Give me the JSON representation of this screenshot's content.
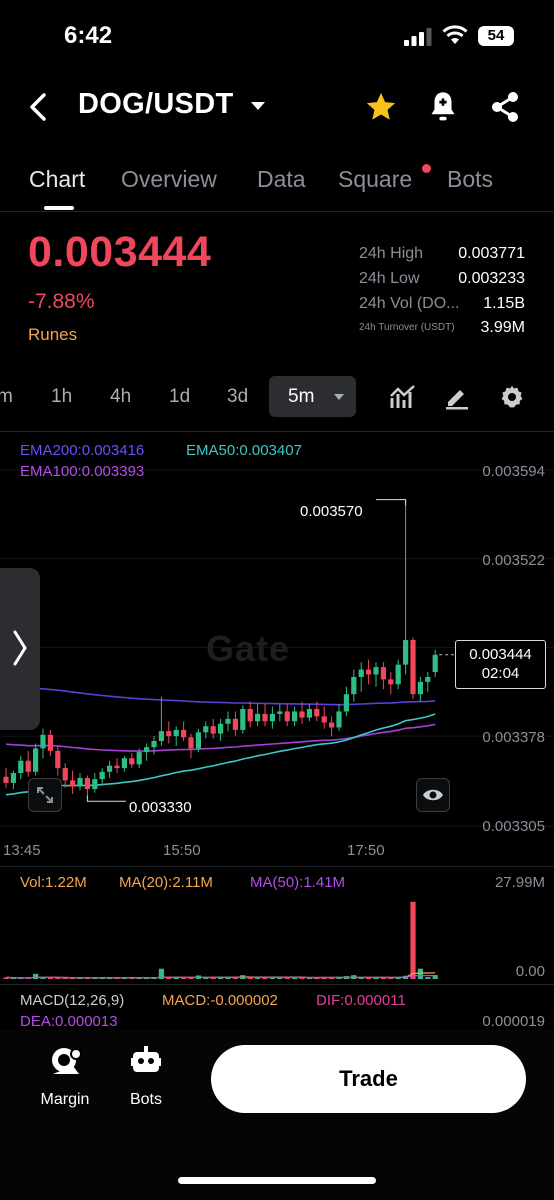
{
  "status_bar": {
    "time": "6:42",
    "battery": "54"
  },
  "header": {
    "pair": "DOG/USDT"
  },
  "tabs": [
    {
      "label": "Chart"
    },
    {
      "label": "Overview"
    },
    {
      "label": "Data"
    },
    {
      "label": "Square"
    },
    {
      "label": "Bots"
    }
  ],
  "ticker": {
    "price": "0.003444",
    "change": "-7.88%",
    "tag": "Runes",
    "stats": [
      {
        "label": "24h High",
        "value": "0.003771"
      },
      {
        "label": "24h Low",
        "value": "0.003233"
      },
      {
        "label": "24h Vol (DO...",
        "value": "1.15B"
      },
      {
        "label": "24h Turnover (USDT)",
        "value": "3.99M"
      }
    ]
  },
  "intervals": [
    "m",
    "1h",
    "4h",
    "1d",
    "3d"
  ],
  "selected_interval": "5m",
  "chart": {
    "ema200": "EMA200:0.003416",
    "ema50": "EMA50:0.003407",
    "ema100": "EMA100:0.003393",
    "price_axis": [
      "0.003594",
      "0.003522",
      "0.003378",
      "0.003305"
    ],
    "high_marker": "0.003570",
    "low_marker": "0.003330",
    "current_price": "0.003444",
    "countdown": "02:04",
    "time_axis": [
      "13:45",
      "15:50",
      "17:50"
    ],
    "watermark": "Gate",
    "colors": {
      "up": "#2ebd85",
      "down": "#f0475d",
      "ema200": "#5b3fd6",
      "ema50": "#3cc8c8",
      "ema100": "#a63fd6"
    }
  },
  "volume": {
    "vol": "Vol:1.22M",
    "ma20": "MA(20):2.11M",
    "ma50": "MA(50):1.41M",
    "axis_top": "27.99M",
    "axis_bottom": "0.00"
  },
  "macd": {
    "title": "MACD(12,26,9)",
    "macd": "MACD:-0.000002",
    "dif": "DIF:0.000011",
    "dea": "DEA:0.000013",
    "axis": "0.000019"
  },
  "bottom_bar": {
    "margin": "Margin",
    "bots": "Bots",
    "trade": "Trade"
  },
  "candles": [
    {
      "o": 0.003345,
      "h": 0.003352,
      "l": 0.003336,
      "c": 0.00334
    },
    {
      "o": 0.00334,
      "h": 0.00335,
      "l": 0.003335,
      "c": 0.003348
    },
    {
      "o": 0.003348,
      "h": 0.003362,
      "l": 0.003343,
      "c": 0.003358
    },
    {
      "o": 0.003358,
      "h": 0.003366,
      "l": 0.003345,
      "c": 0.003349
    },
    {
      "o": 0.003349,
      "h": 0.003372,
      "l": 0.003346,
      "c": 0.003368
    },
    {
      "o": 0.003368,
      "h": 0.003384,
      "l": 0.00336,
      "c": 0.003379
    },
    {
      "o": 0.003379,
      "h": 0.003383,
      "l": 0.003362,
      "c": 0.003366
    },
    {
      "o": 0.003366,
      "h": 0.00337,
      "l": 0.003346,
      "c": 0.003352
    },
    {
      "o": 0.003352,
      "h": 0.003356,
      "l": 0.003336,
      "c": 0.003342
    },
    {
      "o": 0.003342,
      "h": 0.00335,
      "l": 0.003331,
      "c": 0.003337
    },
    {
      "o": 0.003337,
      "h": 0.003348,
      "l": 0.003334,
      "c": 0.003344
    },
    {
      "o": 0.003344,
      "h": 0.003346,
      "l": 0.00333,
      "c": 0.003335
    },
    {
      "o": 0.003335,
      "h": 0.003348,
      "l": 0.003332,
      "c": 0.003343
    },
    {
      "o": 0.003343,
      "h": 0.003352,
      "l": 0.003338,
      "c": 0.003349
    },
    {
      "o": 0.003349,
      "h": 0.003358,
      "l": 0.003344,
      "c": 0.003354
    },
    {
      "o": 0.003354,
      "h": 0.00336,
      "l": 0.003348,
      "c": 0.003352
    },
    {
      "o": 0.003352,
      "h": 0.003362,
      "l": 0.003349,
      "c": 0.00336
    },
    {
      "o": 0.00336,
      "h": 0.003364,
      "l": 0.003352,
      "c": 0.003355
    },
    {
      "o": 0.003355,
      "h": 0.003368,
      "l": 0.003352,
      "c": 0.003365
    },
    {
      "o": 0.003365,
      "h": 0.003372,
      "l": 0.003358,
      "c": 0.003369
    },
    {
      "o": 0.003369,
      "h": 0.003378,
      "l": 0.003363,
      "c": 0.003374
    },
    {
      "o": 0.003374,
      "h": 0.00341,
      "l": 0.00337,
      "c": 0.003382
    },
    {
      "o": 0.003382,
      "h": 0.00339,
      "l": 0.003372,
      "c": 0.003378
    },
    {
      "o": 0.003378,
      "h": 0.003386,
      "l": 0.00337,
      "c": 0.003383
    },
    {
      "o": 0.003383,
      "h": 0.00339,
      "l": 0.003374,
      "c": 0.003377
    },
    {
      "o": 0.003377,
      "h": 0.00338,
      "l": 0.00336,
      "c": 0.003368
    },
    {
      "o": 0.003368,
      "h": 0.003384,
      "l": 0.003365,
      "c": 0.003381
    },
    {
      "o": 0.003381,
      "h": 0.00339,
      "l": 0.003376,
      "c": 0.003386
    },
    {
      "o": 0.003386,
      "h": 0.003392,
      "l": 0.003376,
      "c": 0.00338
    },
    {
      "o": 0.00338,
      "h": 0.003392,
      "l": 0.003374,
      "c": 0.003388
    },
    {
      "o": 0.003388,
      "h": 0.003398,
      "l": 0.003382,
      "c": 0.003392
    },
    {
      "o": 0.003392,
      "h": 0.003398,
      "l": 0.003378,
      "c": 0.003383
    },
    {
      "o": 0.003383,
      "h": 0.003403,
      "l": 0.00338,
      "c": 0.0034
    },
    {
      "o": 0.0034,
      "h": 0.003406,
      "l": 0.003385,
      "c": 0.00339
    },
    {
      "o": 0.00339,
      "h": 0.003404,
      "l": 0.003386,
      "c": 0.003396
    },
    {
      "o": 0.003396,
      "h": 0.003404,
      "l": 0.003386,
      "c": 0.00339
    },
    {
      "o": 0.00339,
      "h": 0.003402,
      "l": 0.003384,
      "c": 0.003396
    },
    {
      "o": 0.003396,
      "h": 0.003404,
      "l": 0.00339,
      "c": 0.003398
    },
    {
      "o": 0.003398,
      "h": 0.003404,
      "l": 0.003386,
      "c": 0.00339
    },
    {
      "o": 0.00339,
      "h": 0.003402,
      "l": 0.003386,
      "c": 0.003398
    },
    {
      "o": 0.003398,
      "h": 0.003406,
      "l": 0.003388,
      "c": 0.003393
    },
    {
      "o": 0.003393,
      "h": 0.003404,
      "l": 0.00339,
      "c": 0.0034
    },
    {
      "o": 0.0034,
      "h": 0.003406,
      "l": 0.00339,
      "c": 0.003394
    },
    {
      "o": 0.003394,
      "h": 0.003402,
      "l": 0.003384,
      "c": 0.003389
    },
    {
      "o": 0.003389,
      "h": 0.003394,
      "l": 0.003378,
      "c": 0.003385
    },
    {
      "o": 0.003385,
      "h": 0.003404,
      "l": 0.003382,
      "c": 0.003398
    },
    {
      "o": 0.003398,
      "h": 0.003418,
      "l": 0.003394,
      "c": 0.003412
    },
    {
      "o": 0.003412,
      "h": 0.003432,
      "l": 0.003406,
      "c": 0.003426
    },
    {
      "o": 0.003426,
      "h": 0.003438,
      "l": 0.003414,
      "c": 0.003432
    },
    {
      "o": 0.003432,
      "h": 0.00344,
      "l": 0.00342,
      "c": 0.003428
    },
    {
      "o": 0.003428,
      "h": 0.003438,
      "l": 0.003418,
      "c": 0.003434
    },
    {
      "o": 0.003434,
      "h": 0.003438,
      "l": 0.003416,
      "c": 0.003424
    },
    {
      "o": 0.003424,
      "h": 0.00343,
      "l": 0.003412,
      "c": 0.00342
    },
    {
      "o": 0.00342,
      "h": 0.00344,
      "l": 0.003416,
      "c": 0.003436
    },
    {
      "o": 0.003436,
      "h": 0.00357,
      "l": 0.003428,
      "c": 0.003456
    },
    {
      "o": 0.003456,
      "h": 0.003458,
      "l": 0.003408,
      "c": 0.003412
    },
    {
      "o": 0.003412,
      "h": 0.003426,
      "l": 0.003406,
      "c": 0.003422
    },
    {
      "o": 0.003422,
      "h": 0.00343,
      "l": 0.003414,
      "c": 0.003426
    },
    {
      "o": 0.00343,
      "h": 0.003448,
      "l": 0.003426,
      "c": 0.003444
    }
  ],
  "volumes": [
    0.5,
    0.4,
    0.2,
    0.1,
    1.6,
    0.3,
    0.5,
    0.3,
    0.4,
    0.2,
    0.3,
    0.2,
    0.3,
    0.4,
    0.6,
    0.3,
    0.2,
    0.5,
    0.3,
    0.4,
    0.5,
    3.2,
    0.4,
    0.3,
    0.4,
    0.5,
    1.1,
    0.3,
    0.4,
    0.3,
    0.5,
    0.6,
    1.2,
    0.3,
    0.2,
    0.4,
    0.3,
    0.2,
    0.3,
    0.4,
    0.3,
    0.5,
    0.3,
    0.6,
    0.5,
    0.7,
    0.9,
    1.2,
    0.6,
    0.5,
    0.4,
    0.3,
    0.5,
    0.6,
    1.0,
    24.0,
    3.2,
    0.6,
    1.22
  ]
}
